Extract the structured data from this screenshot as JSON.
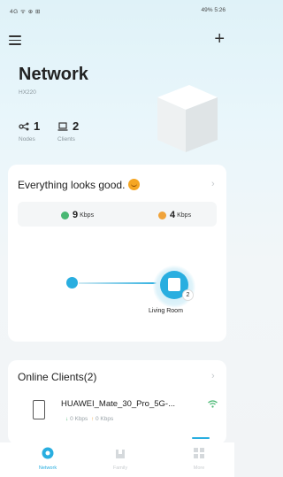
{
  "status_bar": {
    "left": "4G ᯤ ⊕ ⊞",
    "right": "49% 5:26"
  },
  "header": {
    "title": "Network",
    "model": "HX220"
  },
  "stats": {
    "nodes_count": "1",
    "nodes_label": "Nodes",
    "clients_count": "2",
    "clients_label": "Clients"
  },
  "status_card": {
    "title": "Everything looks good.",
    "upload_value": "9",
    "upload_unit": "Kbps",
    "download_value": "4",
    "download_unit": "Kbps",
    "node_name": "Living Room",
    "node_badge": "2"
  },
  "clients_card": {
    "title": "Online Clients(2)",
    "client_name": "HUAWEI_Mate_30_Pro_5G-...",
    "client_up": "0 Kbps",
    "client_down": "0 Kbps"
  },
  "nav": {
    "network": "Network",
    "family": "Family",
    "more": "More"
  },
  "colors": {
    "accent": "#29aee0",
    "up": "#49b873",
    "down": "#f0a33a"
  }
}
